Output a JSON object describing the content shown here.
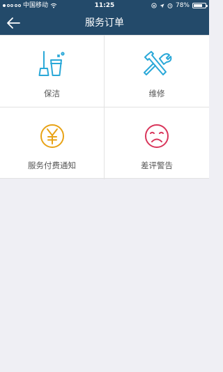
{
  "status_bar": {
    "carrier": "中国移动",
    "time": "11:25",
    "battery_text": "78%",
    "battery_level": 0.78,
    "signal_bars_filled": 1,
    "signal_bars_total": 5
  },
  "nav": {
    "title": "服务订单",
    "back_icon": "arrow-left-icon"
  },
  "colors": {
    "header_bg": "#234a6a",
    "cleaning_icon": "#2aa8d8",
    "repair_icon": "#2aa8d8",
    "payment_icon": "#e8a317",
    "bad_review_icon": "#d9365b"
  },
  "tiles": [
    {
      "label": "保洁",
      "icon": "cleaning-icon"
    },
    {
      "label": "维修",
      "icon": "repair-tools-icon"
    },
    {
      "label": "服务付费通知",
      "icon": "yen-coin-icon"
    },
    {
      "label": "差评警告",
      "icon": "sad-face-icon"
    }
  ]
}
